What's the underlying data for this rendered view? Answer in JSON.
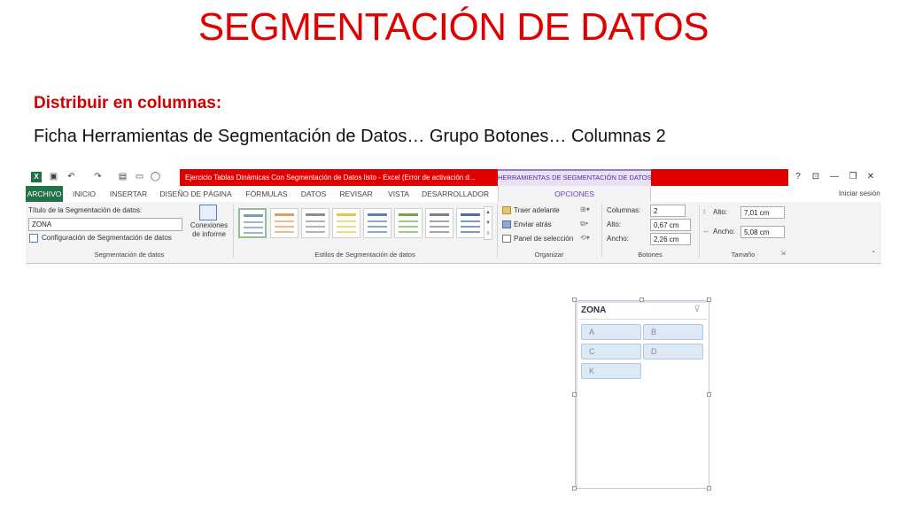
{
  "slide": {
    "title": "SEGMENTACIÓN DE DATOS",
    "subtitle": "Distribuir en columnas:",
    "body": "Ficha Herramientas de Segmentación de Datos… Grupo  Botones… Columnas  2"
  },
  "excel": {
    "window_title": "Ejercicio Tablas Dinámicas Con Segmentación de Datos listo -  Excel (Error de activación d...",
    "tools_tab": "HERRAMIENTAS DE SEGMENTACIÓN DE DATOS",
    "help": "?",
    "signin": "Iniciar sesión",
    "tabs": [
      "ARCHIVO",
      "INICIO",
      "INSERTAR",
      "DISEÑO DE PÁGINA",
      "FÓRMULAS",
      "DATOS",
      "REVISAR",
      "VISTA",
      "DESARROLLADOR",
      "OPCIONES"
    ],
    "ribbon": {
      "caption_label": "Título de la Segmentación de datos:",
      "caption_value": "ZONA",
      "settings_label": "Configuración de Segmentación de datos",
      "connections_label": "Conexiones de informe",
      "group_segmentacion": "Segmentación de datos",
      "group_estilos": "Estilos de Segmentación de datos",
      "bring_forward": "Traer adelante",
      "send_backward": "Enviar atrás",
      "selection_pane": "Panel de selección",
      "group_organizar": "Organizar",
      "columns_label": "Columnas:",
      "columns_value": "2",
      "height_label": "Alto:",
      "height_value": "0,67 cm",
      "width_label": "Ancho:",
      "width_value": "2,26 cm",
      "group_botones": "Botones",
      "size_height_label": "Alto:",
      "size_height_value": "7,01 cm",
      "size_width_label": "Ancho:",
      "size_width_value": "5,08 cm",
      "group_tamano": "Tamaño"
    },
    "colors": {
      "title_red": "#e00000",
      "archivo_green": "#217346",
      "tools_purple": "#7b3fc4"
    }
  },
  "slicer": {
    "header": "ZONA",
    "items": [
      "A",
      "B",
      "C",
      "D",
      "K"
    ]
  }
}
